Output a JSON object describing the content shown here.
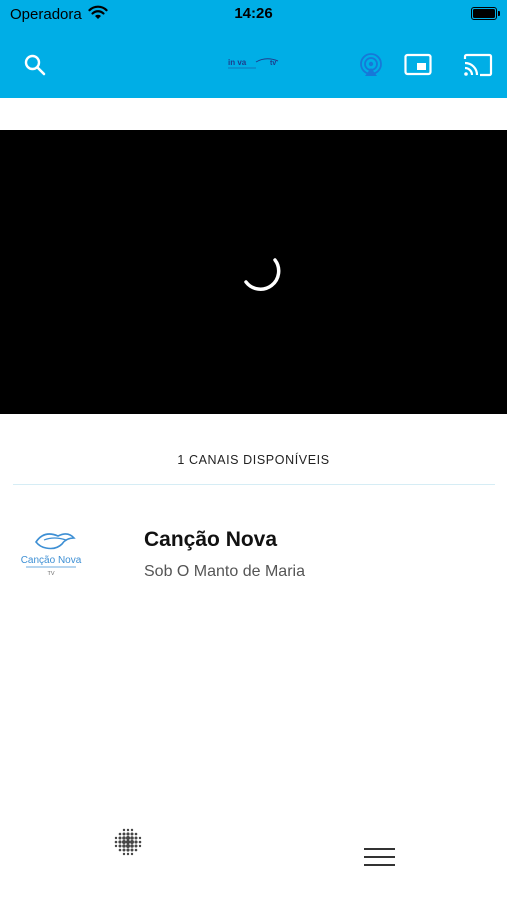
{
  "status_bar": {
    "carrier": "Operadora",
    "time": "14:26"
  },
  "app_bar": {
    "color": "#00aee6",
    "logo_text_left": "in va",
    "logo_text_right": "tv",
    "icons": [
      "search-icon",
      "airplay-icon",
      "picture-in-picture-icon",
      "cast-icon"
    ]
  },
  "player": {
    "state": "loading"
  },
  "channels": {
    "count_label": "1 CANAIS DISPONÍVEIS",
    "items": [
      {
        "name": "Canção Nova",
        "program": "Sob O Manto de Maria",
        "logo_text": "Canção Nova",
        "logo_subtext": "TV"
      }
    ]
  },
  "bottom_bar": {
    "icons": [
      "dots-grid-icon",
      "menu-icon"
    ]
  }
}
